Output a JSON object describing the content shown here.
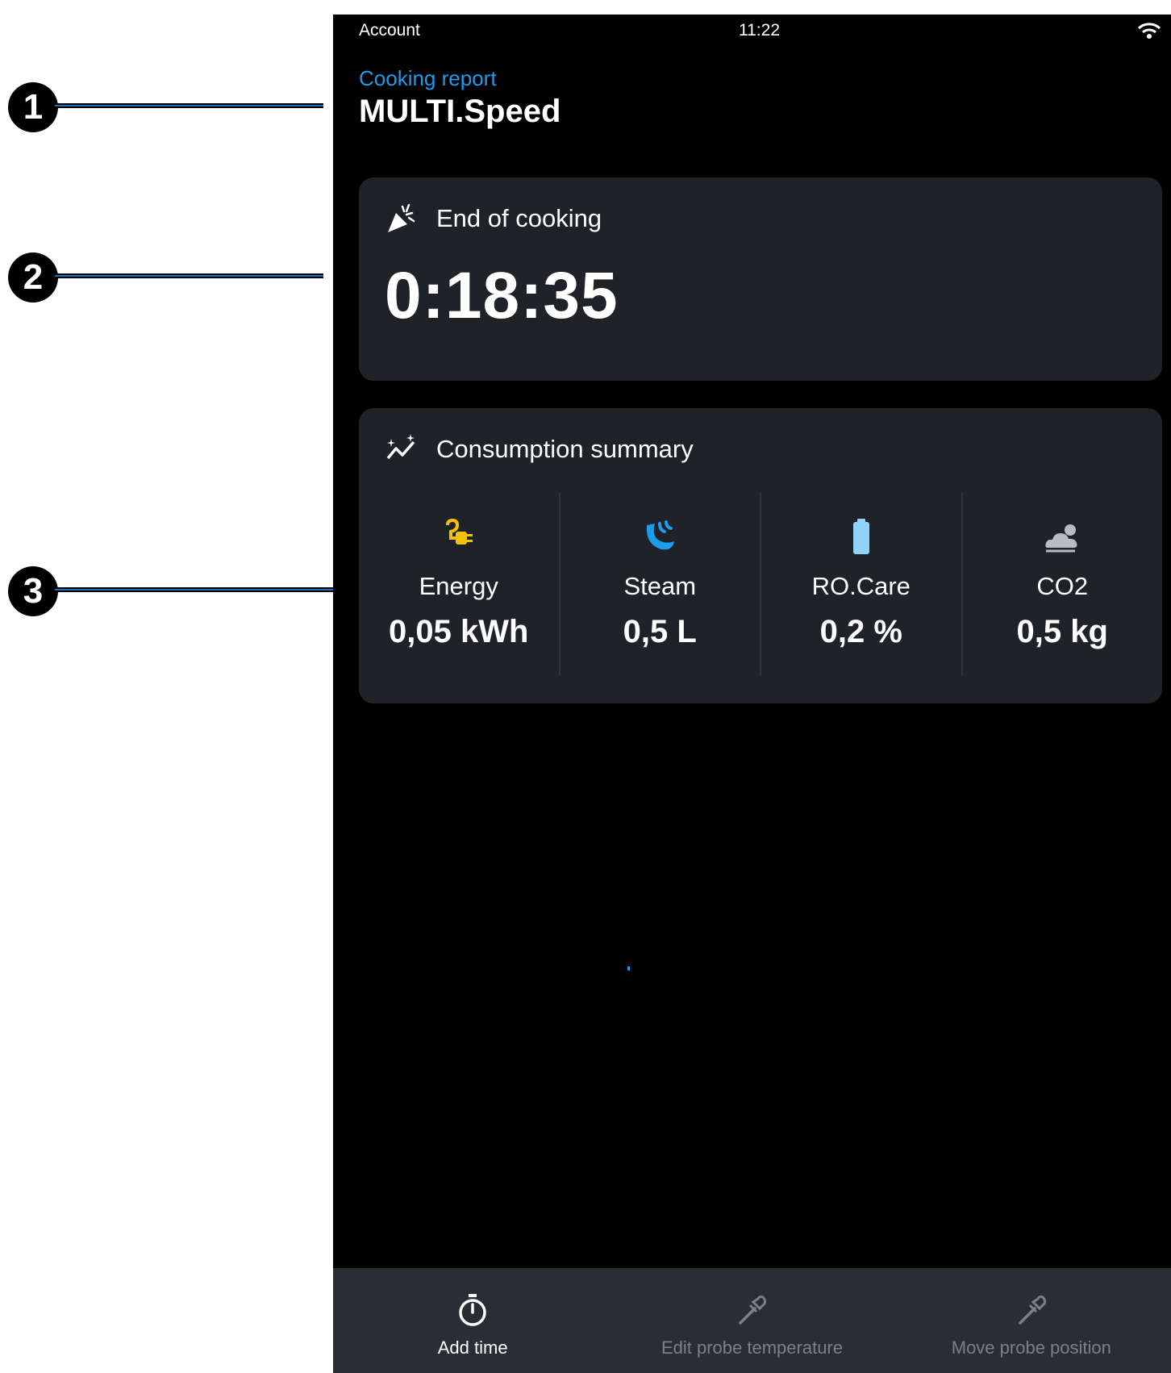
{
  "callouts": [
    "1",
    "2",
    "3"
  ],
  "status_bar": {
    "left": "Account",
    "time": "11:22",
    "wifi_icon": "wifi-icon"
  },
  "header": {
    "breadcrumb": "Cooking report",
    "title": "MULTI.Speed"
  },
  "end_card": {
    "label": "End of cooking",
    "time": "0:18:35",
    "icon": "party-popper-icon"
  },
  "consumption": {
    "label": "Consumption summary",
    "icon": "sparkle-trend-icon",
    "items": [
      {
        "label": "Energy",
        "value": "0,05 kWh",
        "icon": "plug-icon",
        "color": "#f2c200"
      },
      {
        "label": "Steam",
        "value": "0,5 L",
        "icon": "steam-icon",
        "color": "#1e9bea"
      },
      {
        "label": "RO.Care",
        "value": "0,2 %",
        "icon": "battery-icon",
        "color": "#8fd3f8"
      },
      {
        "label": "CO2",
        "value": "0,5 kg",
        "icon": "cloud-icon",
        "color": "#b8bcc2"
      }
    ]
  },
  "bottom_bar": [
    {
      "label": "Add time",
      "icon": "stopwatch-icon",
      "enabled": true
    },
    {
      "label": "Edit probe temperature",
      "icon": "probe-icon",
      "enabled": false
    },
    {
      "label": "Move probe position",
      "icon": "probe-icon",
      "enabled": false
    }
  ]
}
